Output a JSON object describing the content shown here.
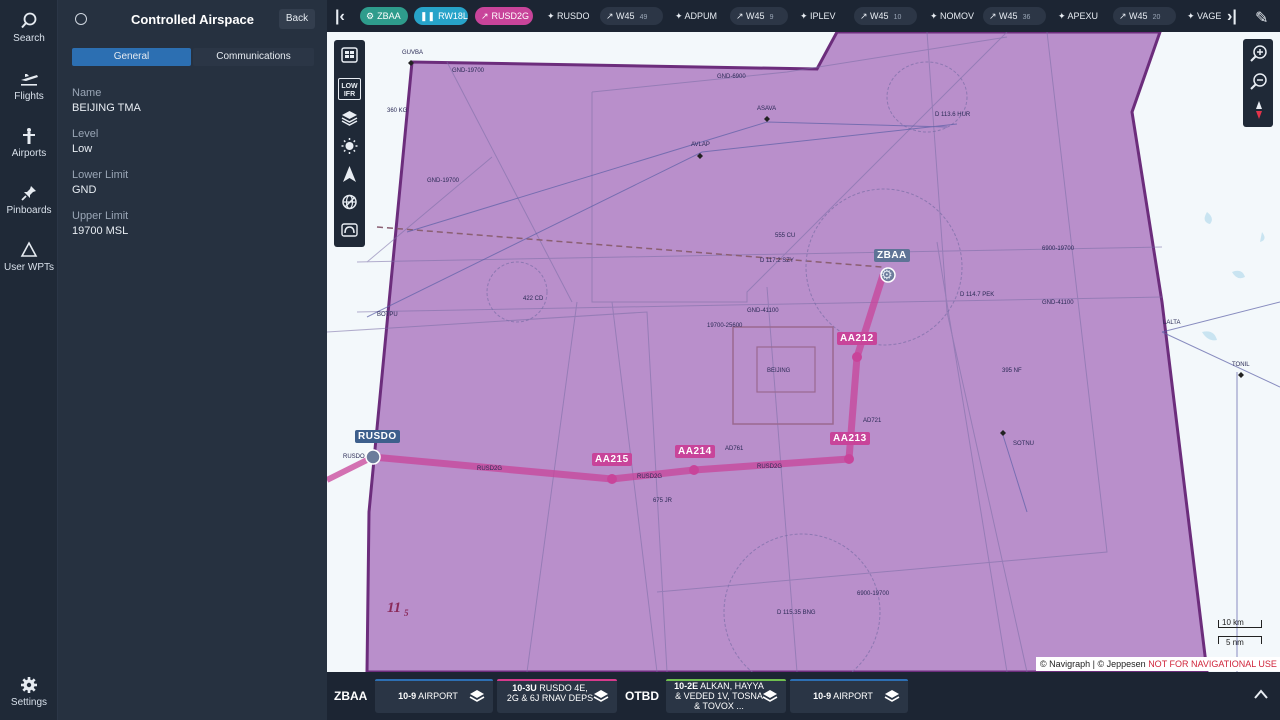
{
  "nav": {
    "items": [
      {
        "label": "Search",
        "icon": "search-icon"
      },
      {
        "label": "Flights",
        "icon": "plane-icon"
      },
      {
        "label": "Airports",
        "icon": "airport-icon"
      },
      {
        "label": "Pinboards",
        "icon": "pin-icon"
      },
      {
        "label": "User WPTs",
        "icon": "triangle-icon"
      }
    ],
    "settings_label": "Settings"
  },
  "panel": {
    "title": "Controlled Airspace",
    "back_label": "Back",
    "tabs": [
      "General",
      "Communications"
    ],
    "fields": [
      {
        "label": "Name",
        "value": "BEIJING TMA"
      },
      {
        "label": "Level",
        "value": "Low"
      },
      {
        "label": "Lower Limit",
        "value": "GND"
      },
      {
        "label": "Upper Limit",
        "value": "19700 MSL"
      }
    ]
  },
  "route": {
    "airport": "ZBAA",
    "runway": "RW18L",
    "sid": "RUSD2G",
    "waypoints": [
      "RUSDO",
      "ADPUM",
      "IPLEV",
      "NOMOV",
      "APEXU",
      "VAGE"
    ],
    "airways": [
      {
        "name": "W45",
        "count": "49"
      },
      {
        "name": "W45",
        "count": "9"
      },
      {
        "name": "W45",
        "count": "10"
      },
      {
        "name": "W45",
        "count": "36"
      },
      {
        "name": "W45",
        "count": "20"
      }
    ]
  },
  "map": {
    "layer_toggle": "LOW IFR",
    "route_labels": {
      "zbaa": "ZBAA",
      "rusdo": "RUSDO",
      "aa212": "AA212",
      "aa213": "AA213",
      "aa214": "AA214",
      "aa215": "AA215"
    },
    "sector_number": "11",
    "sector_sub": "5",
    "small_labels": {
      "guvba": "GUVBA",
      "asava": "ASAVA",
      "avlap": "AVLAP",
      "botpu": "BOTPU",
      "ad761": "AD761",
      "ad721": "AD721",
      "sotnu": "SOTNU",
      "tonil": "TONIL",
      "lalta": "LALTA",
      "beijing": "BEIJING",
      "rusdo_wp": "RUSDO",
      "rusd2g_1": "RUSD2G",
      "rusd2g_2": "RUSD2G",
      "rusd2g_3": "RUSD2G",
      "vor1": "D 113.6 HUR",
      "vor2": "D 117.2 SZY",
      "vor3": "D 114.7 PEK",
      "vor4": "555 CU",
      "vor5": "422 CD",
      "vor6": "360 KG",
      "vor7": "395 NF",
      "vor8": "675 JR",
      "vor9": "D 115.35 BNG",
      "mea1": "GND-19700",
      "mea2": "GND-6900",
      "mea3": "6900-19700",
      "mea4": "GND-41100",
      "mea5": "19700-25600",
      "mea6": "GND-19700",
      "mea7": "GND-41100",
      "mea8": "6900-19700"
    },
    "copyright": "© Navigraph | © Jeppesen",
    "warning": "NOT FOR NAVIGATIONAL USE",
    "scale_km": "10 km",
    "scale_nm": "5 nm"
  },
  "bottom": {
    "dep_icao": "ZBAA",
    "arr_icao": "OTBD",
    "cards": [
      {
        "code": "10-9",
        "text": "AIRPORT",
        "color": "#2d6fb3"
      },
      {
        "code": "10-3U",
        "text": "RUSDO 4E, 2G & 6J RNAV DEPS",
        "color": "#d63a8c"
      },
      {
        "code": "10-2E",
        "text": "ALKAN, HAYYA & VEDED 1V, TOSNA & TOVOX ...",
        "color": "#6fbf4f"
      },
      {
        "code": "10-9",
        "text": "AIRPORT",
        "color": "#2d6fb3"
      }
    ]
  },
  "colors": {
    "airspace_fill": "#b98fcb",
    "route": "#c8449a",
    "panel_bg": "#263140",
    "accent_blue": "#2c6fb2"
  }
}
